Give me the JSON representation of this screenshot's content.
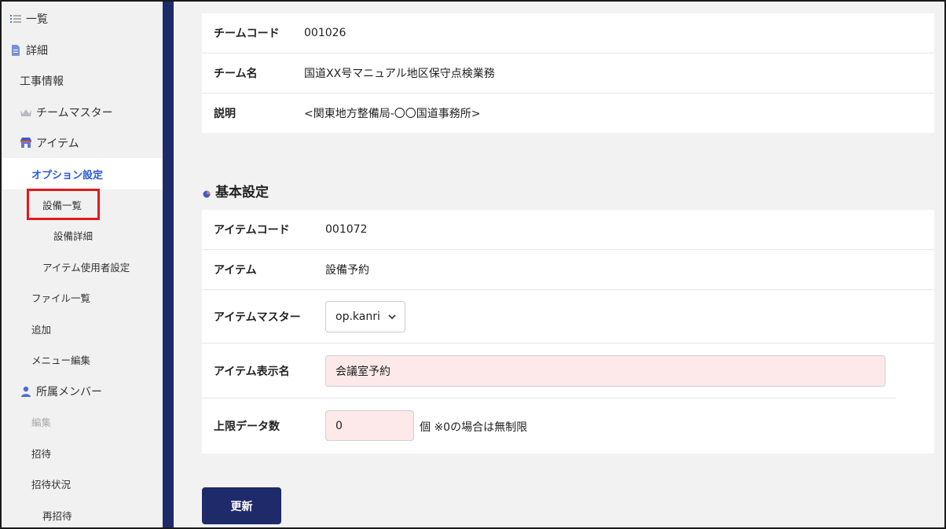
{
  "sidebar": {
    "items": [
      {
        "label": "一覧",
        "icon": "list-icon"
      },
      {
        "label": "詳細",
        "icon": "document-icon"
      },
      {
        "label": "工事情報"
      },
      {
        "label": "チームマスター",
        "icon": "crown-icon"
      },
      {
        "label": "アイテム",
        "icon": "store-icon"
      },
      {
        "label": "オプション設定",
        "state": "active"
      },
      {
        "label": "設備一覧",
        "state": "highlighted"
      },
      {
        "label": "設備詳細"
      },
      {
        "label": "アイテム使用者設定"
      },
      {
        "label": "ファイル一覧"
      },
      {
        "label": "追加"
      },
      {
        "label": "メニュー編集"
      },
      {
        "label": "所属メンバー",
        "icon": "person-icon"
      },
      {
        "label": "編集",
        "state": "disabled"
      },
      {
        "label": "招待"
      },
      {
        "label": "招待状況"
      },
      {
        "label": "再招待"
      }
    ]
  },
  "team": {
    "code_label": "チームコード",
    "code_value": "001026",
    "name_label": "チーム名",
    "name_value": "国道XX号マニュアル地区保守点検業務",
    "desc_label": "説明",
    "desc_value": "<関東地方整備局-〇〇国道事務所>"
  },
  "basic": {
    "title": "基本設定",
    "item_code_label": "アイテムコード",
    "item_code_value": "001072",
    "item_label": "アイテム",
    "item_value": "設備予約",
    "master_label": "アイテムマスター",
    "master_selected": "op.kanri",
    "display_name_label": "アイテム表示名",
    "display_name_value": "会議室予約",
    "limit_label": "上限データ数",
    "limit_value": "0",
    "limit_note": "個 ※0の場合は無制限"
  },
  "actions": {
    "update_label": "更新"
  },
  "colors": {
    "accent_blue": "#2b5bd7",
    "navy": "#1f2a6b",
    "highlight_red": "#e01b1b",
    "input_pink": "#fde9e9"
  }
}
